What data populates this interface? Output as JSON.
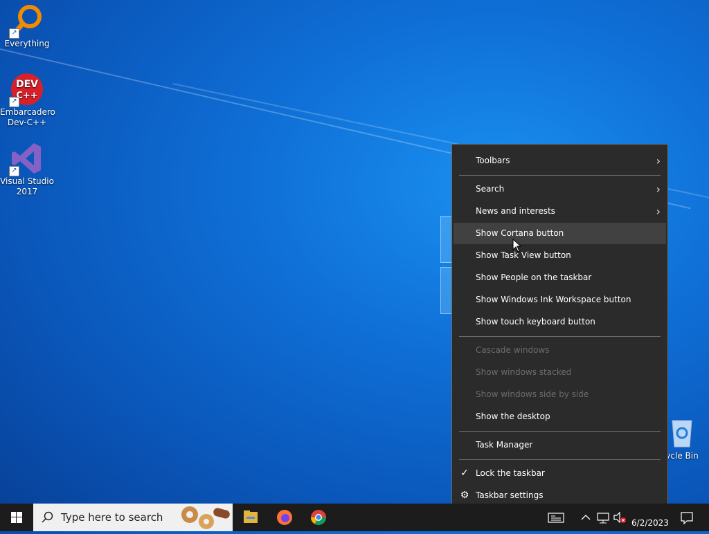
{
  "desktop": {
    "icons": [
      {
        "label": "Everything",
        "icon": "everything-search-icon"
      },
      {
        "label": "Embarcadero Dev-C++",
        "icon": "devcpp-icon",
        "badge": "DEV C++"
      },
      {
        "label": "Visual Studio 2017",
        "icon": "visual-studio-icon"
      },
      {
        "label": "ycle Bin",
        "icon": "recycle-bin-icon"
      }
    ]
  },
  "context_menu": {
    "items": [
      {
        "label": "Toolbars",
        "submenu": true
      },
      {
        "label": "Search",
        "submenu": true
      },
      {
        "label": "News and interests",
        "submenu": true
      },
      {
        "label": "Show Cortana button",
        "hovered": true
      },
      {
        "label": "Show Task View button"
      },
      {
        "label": "Show People on the taskbar"
      },
      {
        "label": "Show Windows Ink Workspace button"
      },
      {
        "label": "Show touch keyboard button"
      },
      {
        "label": "Cascade windows",
        "disabled": true
      },
      {
        "label": "Show windows stacked",
        "disabled": true
      },
      {
        "label": "Show windows side by side",
        "disabled": true
      },
      {
        "label": "Show the desktop"
      },
      {
        "label": "Task Manager"
      },
      {
        "label": "Lock the taskbar",
        "checked": true
      },
      {
        "label": "Taskbar settings",
        "icon": "gear-icon"
      }
    ]
  },
  "taskbar": {
    "search_placeholder": "Type here to search",
    "pinned": [
      "file-explorer-icon",
      "firefox-icon",
      "chrome-icon"
    ],
    "date": "6/2/2023",
    "colors": {
      "menu_bg": "#2b2b2b",
      "taskbar_bg": "#1c1c1c",
      "accent": "#0a55b8"
    }
  }
}
